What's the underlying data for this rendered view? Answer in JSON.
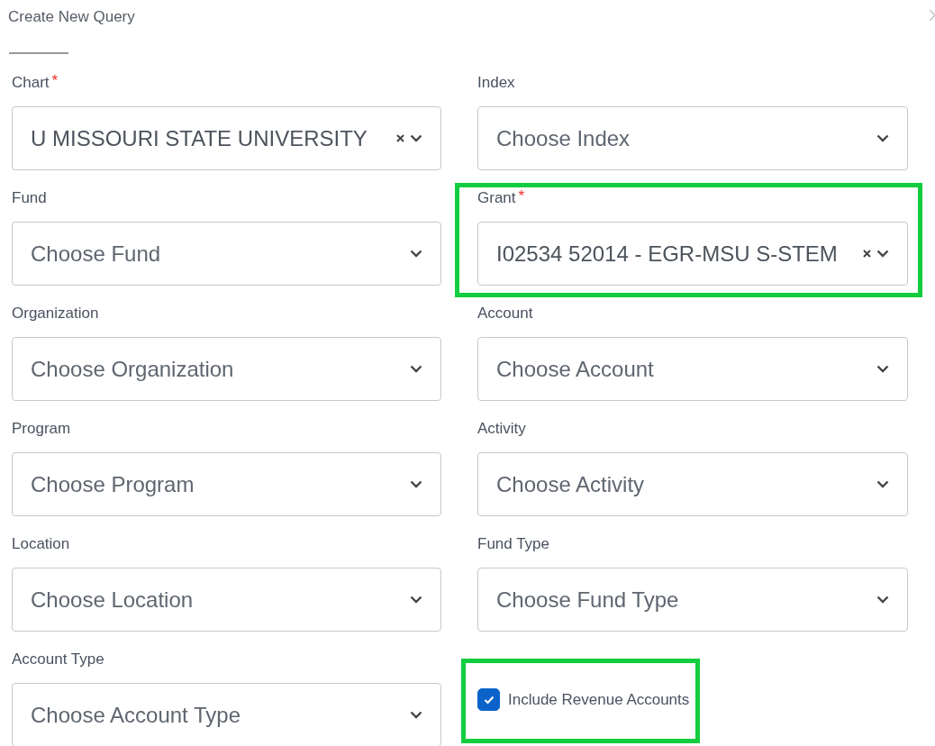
{
  "title": "Create New Query",
  "fields": [
    {
      "label": "Chart",
      "required_mark": "*",
      "value": "U MISSOURI STATE UNIVERSITY",
      "highlighted": false
    },
    {
      "label": "Index",
      "placeholder": "Choose Index",
      "highlighted": false
    },
    {
      "label": "Fund",
      "placeholder": "Choose Fund",
      "highlighted": false
    },
    {
      "label": "Grant",
      "required_mark": "*",
      "value": "I02534 52014 - EGR-MSU S-STEM",
      "highlighted": true
    },
    {
      "label": "Organization",
      "placeholder": "Choose Organization",
      "highlighted": false
    },
    {
      "label": "Account",
      "placeholder": "Choose Account",
      "highlighted": false
    },
    {
      "label": "Program",
      "placeholder": "Choose Program",
      "highlighted": false
    },
    {
      "label": "Activity",
      "placeholder": "Choose Activity",
      "highlighted": false
    },
    {
      "label": "Location",
      "placeholder": "Choose Location",
      "highlighted": false
    },
    {
      "label": "Fund Type",
      "placeholder": "Choose Fund Type",
      "highlighted": false
    },
    {
      "label": "Account Type",
      "placeholder": "Choose Account Type",
      "highlighted": false
    }
  ],
  "include_revenue": {
    "label": "Include Revenue Accounts",
    "checked": true,
    "highlighted": true
  }
}
